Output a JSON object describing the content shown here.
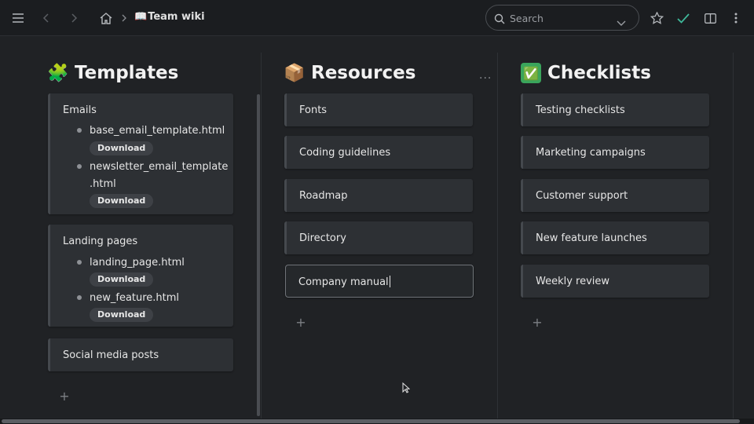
{
  "breadcrumb": {
    "emoji": "📖",
    "title": "Team wiki"
  },
  "search": {
    "placeholder": "Search"
  },
  "icons": [
    "menu-icon",
    "back-icon",
    "forward-icon",
    "home-icon",
    "chevron-right-icon",
    "search-icon",
    "chevron-down-icon",
    "star-icon",
    "check-icon",
    "sidebar-toggle-icon",
    "more-vertical-icon"
  ],
  "colors": {
    "check": "#3fb89a",
    "background": "#202225",
    "card": "#2d3034"
  },
  "columns": [
    {
      "emoji": "🧩",
      "title": "Templates",
      "cards": [
        {
          "label": "Emails",
          "files": [
            {
              "name": "base_email_template.html",
              "button": "Download"
            },
            {
              "name_line1": "newsletter_email_template",
              "name_line2": ".html",
              "button": "Download"
            }
          ]
        },
        {
          "label": "Landing pages",
          "files": [
            {
              "name": "landing_page.html",
              "button": "Download"
            },
            {
              "name": "new_feature.html",
              "button": "Download"
            }
          ]
        },
        {
          "label": "Social media posts"
        }
      ],
      "add": "+"
    },
    {
      "emoji": "📦",
      "title": "Resources",
      "more": "···",
      "cards": [
        {
          "label": "Fonts"
        },
        {
          "label": "Coding guidelines"
        },
        {
          "label": "Roadmap"
        },
        {
          "label": "Directory"
        },
        {
          "label": "Company manual"
        }
      ],
      "add": "+"
    },
    {
      "emoji": "✅",
      "title": "Checklists",
      "cards": [
        {
          "label": "Testing checklists"
        },
        {
          "label": "Marketing campaigns"
        },
        {
          "label": "Customer support"
        },
        {
          "label": "New feature launches"
        },
        {
          "label": "Weekly review"
        }
      ],
      "add": "+"
    }
  ]
}
